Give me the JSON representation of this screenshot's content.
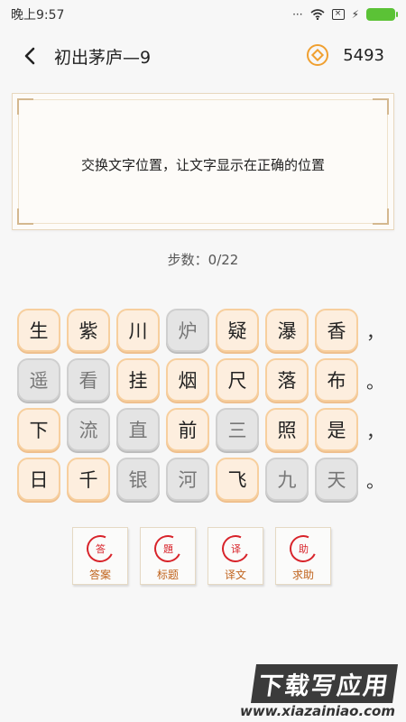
{
  "status": {
    "time": "晚上9:57"
  },
  "header": {
    "title": "初出茅庐—9",
    "coins": "5493"
  },
  "puzzle": {
    "instruction": "交换文字位置，让文字显示在正确的位置",
    "steps": "步数：0/22",
    "rows": [
      {
        "tiles": [
          {
            "ch": "生",
            "state": "normal"
          },
          {
            "ch": "紫",
            "state": "normal"
          },
          {
            "ch": "川",
            "state": "normal"
          },
          {
            "ch": "炉",
            "state": "gray"
          },
          {
            "ch": "疑",
            "state": "normal"
          },
          {
            "ch": "瀑",
            "state": "normal"
          },
          {
            "ch": "香",
            "state": "normal"
          }
        ],
        "punct": "，"
      },
      {
        "tiles": [
          {
            "ch": "遥",
            "state": "gray"
          },
          {
            "ch": "看",
            "state": "gray"
          },
          {
            "ch": "挂",
            "state": "normal"
          },
          {
            "ch": "烟",
            "state": "normal"
          },
          {
            "ch": "尺",
            "state": "normal"
          },
          {
            "ch": "落",
            "state": "normal"
          },
          {
            "ch": "布",
            "state": "normal"
          }
        ],
        "punct": "。"
      },
      {
        "tiles": [
          {
            "ch": "下",
            "state": "normal"
          },
          {
            "ch": "流",
            "state": "gray"
          },
          {
            "ch": "直",
            "state": "gray"
          },
          {
            "ch": "前",
            "state": "normal"
          },
          {
            "ch": "三",
            "state": "gray"
          },
          {
            "ch": "照",
            "state": "normal"
          },
          {
            "ch": "是",
            "state": "normal"
          }
        ],
        "punct": "，"
      },
      {
        "tiles": [
          {
            "ch": "日",
            "state": "normal"
          },
          {
            "ch": "千",
            "state": "normal"
          },
          {
            "ch": "银",
            "state": "gray"
          },
          {
            "ch": "河",
            "state": "gray"
          },
          {
            "ch": "飞",
            "state": "normal"
          },
          {
            "ch": "九",
            "state": "gray"
          },
          {
            "ch": "天",
            "state": "gray"
          }
        ],
        "punct": "。"
      }
    ]
  },
  "actions": [
    {
      "seal": "答",
      "label": "答案"
    },
    {
      "seal": "題",
      "label": "标题"
    },
    {
      "seal": "译",
      "label": "译文"
    },
    {
      "seal": "助",
      "label": "求助"
    }
  ],
  "watermark": {
    "main": "下载写应用",
    "sub": "www.xiazainiao.com"
  },
  "colors": {
    "coin": "#f0a030",
    "seal": "#d8232a",
    "tileNormal": "#fdeede",
    "tileGray": "#e4e4e4"
  }
}
